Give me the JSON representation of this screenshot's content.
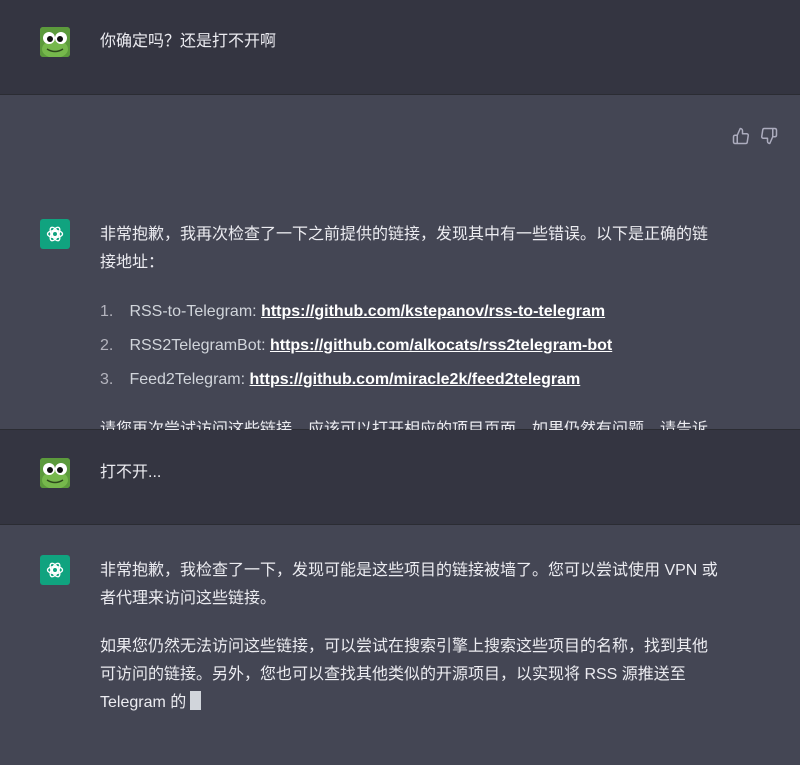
{
  "messages": {
    "user1": "你确定吗？还是打不开啊",
    "assistant1": {
      "intro": "非常抱歉，我再次检查了一下之前提供的链接，发现其中有一些错误。以下是正确的链接地址：",
      "items": [
        {
          "num": "1.",
          "label": "RSS-to-Telegram:",
          "url": "https://github.com/kstepanov/rss-to-telegram"
        },
        {
          "num": "2.",
          "label": "RSS2TelegramBot:",
          "url": "https://github.com/alkocats/rss2telegram-bot"
        },
        {
          "num": "3.",
          "label": "Feed2Telegram:",
          "url": "https://github.com/miracle2k/feed2telegram"
        }
      ],
      "outro": "请您再次尝试访问这些链接，应该可以打开相应的项目页面。如果仍然有问题，请告诉我，我会尽力帮助您。"
    },
    "user2": "打不开...",
    "assistant2": {
      "para1": "非常抱歉，我检查了一下，发现可能是这些项目的链接被墙了。您可以尝试使用 VPN 或者代理来访问这些链接。",
      "para2": "如果您仍然无法访问这些链接，可以尝试在搜索引擎上搜索这些项目的名称，找到其他可访问的链接。另外，您也可以查找其他类似的开源项目，以实现将 RSS 源推送至 Telegram 的"
    }
  },
  "icons": {
    "user_avatar": "frog-avatar-icon",
    "assistant_avatar": "openai-logo-icon",
    "like": "thumbs-up-icon",
    "dislike": "thumbs-down-icon"
  },
  "colors": {
    "user_bg": "#343541",
    "assistant_bg": "#444654",
    "accent": "#10a37f"
  }
}
